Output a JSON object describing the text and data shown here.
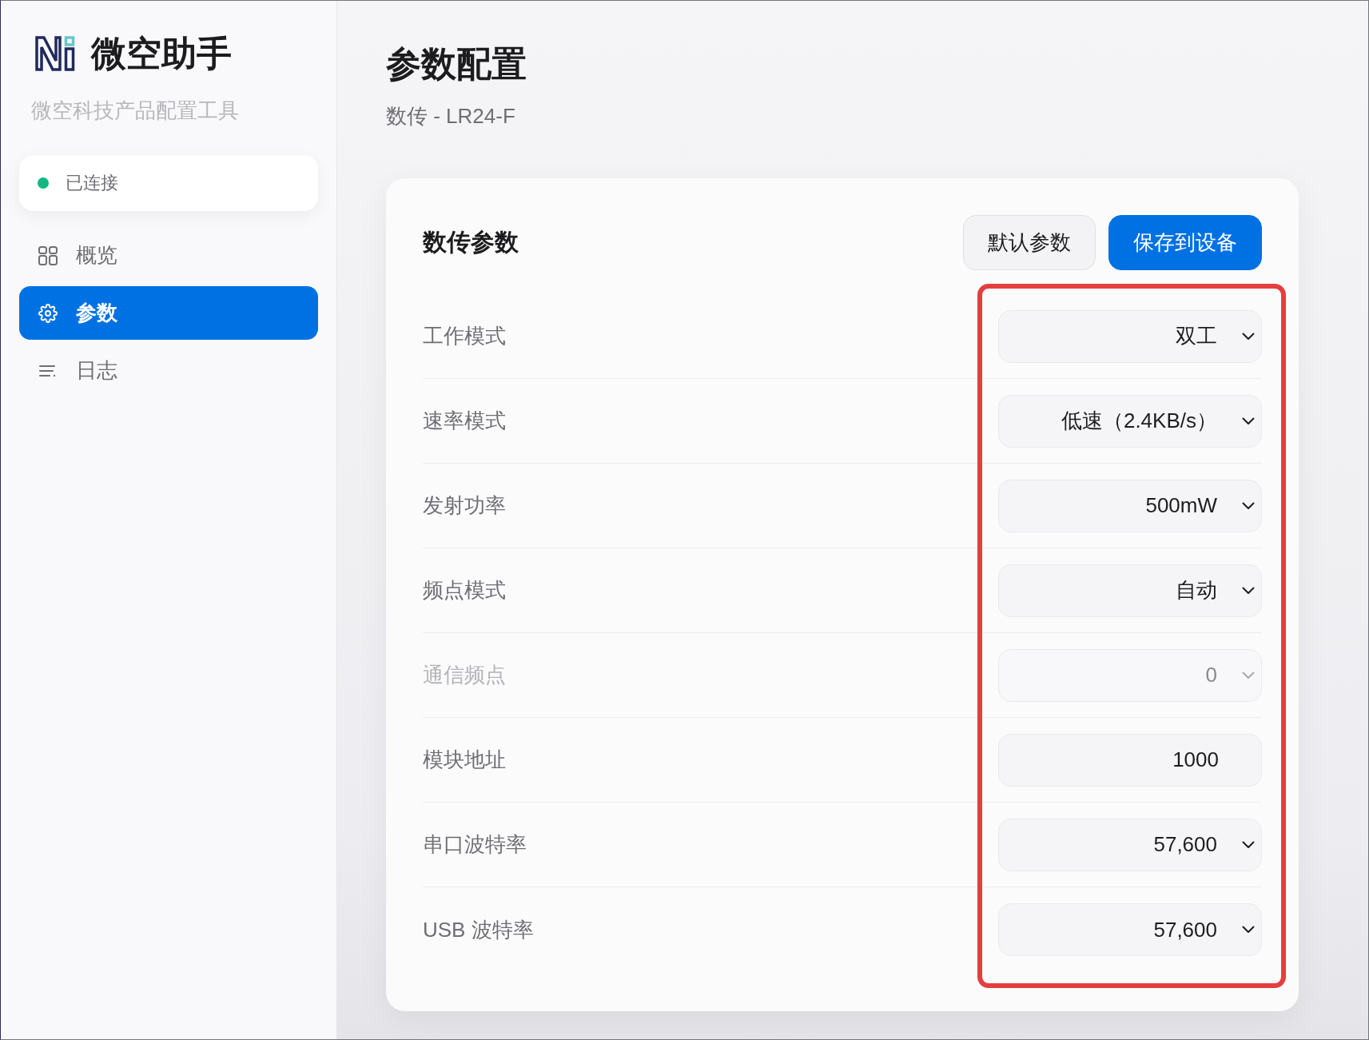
{
  "sidebar": {
    "app_name": "微空助手",
    "tagline": "微空科技产品配置工具",
    "connection": {
      "label": "已连接",
      "connected": true
    },
    "nav": [
      {
        "label": "概览",
        "kind": "overview",
        "selected": false
      },
      {
        "label": "参数",
        "kind": "settings",
        "selected": true
      },
      {
        "label": "日志",
        "kind": "log",
        "selected": false
      }
    ]
  },
  "header": {
    "title": "参数配置",
    "subtitle": "数传 - LR24-F"
  },
  "panel": {
    "title": "数传参数",
    "buttons": [
      {
        "label": "默认参数",
        "kind": "secondary"
      },
      {
        "label": "保存到设备",
        "kind": "primary"
      }
    ],
    "controls_highlighted": true,
    "fields": [
      {
        "label": "工作模式",
        "kind": "select",
        "value": "双工",
        "disabled": false
      },
      {
        "label": "速率模式",
        "kind": "select",
        "value": "低速（2.4KB/s）",
        "disabled": false
      },
      {
        "label": "发射功率",
        "kind": "select",
        "value": "500mW",
        "disabled": false
      },
      {
        "label": "频点模式",
        "kind": "select",
        "value": "自动",
        "disabled": false
      },
      {
        "label": "通信频点",
        "kind": "select",
        "value": "0",
        "disabled": true
      },
      {
        "label": "模块地址",
        "kind": "input",
        "value": "1000",
        "disabled": false
      },
      {
        "label": "串口波特率",
        "kind": "select",
        "value": "57,600",
        "disabled": false
      },
      {
        "label": "USB 波特率",
        "kind": "select",
        "value": "57,600",
        "disabled": false
      }
    ]
  }
}
